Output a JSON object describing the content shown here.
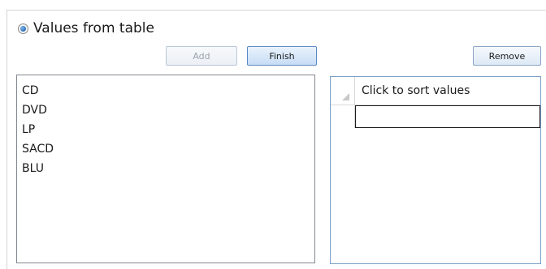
{
  "values_option": {
    "label": "Values from table",
    "selected": true
  },
  "buttons": {
    "add_label": "Add",
    "finish_label": "Finish",
    "remove_label": "Remove"
  },
  "values_list": {
    "items": [
      "CD",
      "DVD",
      "LP",
      "SACD",
      "BLU"
    ]
  },
  "sort_grid": {
    "column_header": "Click to sort values",
    "rows": [
      ""
    ]
  }
}
